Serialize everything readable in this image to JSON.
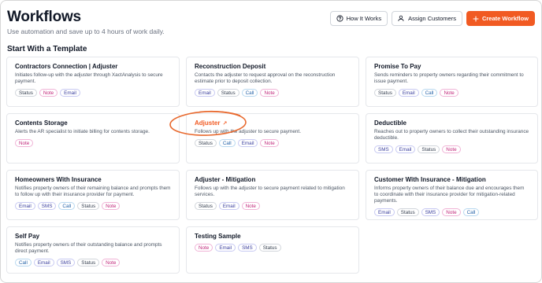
{
  "header": {
    "title": "Workflows",
    "subtitle": "Use automation and save up to 4 hours of work daily.",
    "buttons": {
      "how_it_works": "How It Works",
      "assign_customers": "Assign Customers",
      "create_workflow": "Create Workflow"
    }
  },
  "section_title": "Start With a Template",
  "colors": {
    "accent": "#f15a22",
    "note": "#c0267a",
    "email": "#3b3f9e",
    "call": "#2563a8"
  },
  "templates": [
    {
      "title": "Contractors Connection | Adjuster",
      "desc": "Initiates follow-up with the adjuster through XactAnalysis to secure payment.",
      "tags": [
        "Status",
        "Note",
        "Email"
      ]
    },
    {
      "title": "Reconstruction Deposit",
      "desc": "Contacts the adjuster to request approval on the reconstruction estimate prior to deposit collection.",
      "tags": [
        "Email",
        "Status",
        "Call",
        "Note"
      ]
    },
    {
      "title": "Promise To Pay",
      "desc": "Sends reminders to property owners regarding their commitment to issue payment.",
      "tags": [
        "Status",
        "Email",
        "Call",
        "Note"
      ]
    },
    {
      "title": "Contents Storage",
      "desc": "Alerts the AR specialist to initiate billing for contents storage.",
      "tags": [
        "Note"
      ]
    },
    {
      "title": "Adjuster",
      "desc": "Follows up with the adjuster to secure payment.",
      "tags": [
        "Status",
        "Call",
        "Email",
        "Note"
      ],
      "highlight": true,
      "link_glyph": "↗"
    },
    {
      "title": "Deductible",
      "desc": "Reaches out to property owners to collect their outstanding insurance deductible.",
      "tags": [
        "SMS",
        "Email",
        "Status",
        "Note"
      ]
    },
    {
      "title": "Homeowners With Insurance",
      "desc": "Notifies property owners of their remaining balance and prompts them to follow up with their insurance provider for payment.",
      "tags": [
        "Email",
        "SMS",
        "Call",
        "Status",
        "Note"
      ]
    },
    {
      "title": "Adjuster - Mitigation",
      "desc": "Follows up with the adjuster to secure payment related to mitigation services.",
      "tags": [
        "Status",
        "Email",
        "Note"
      ]
    },
    {
      "title": "Customer With Insurance - Mitigation",
      "desc": "Informs property owners of their balance due and encourages them to coordinate with their insurance provider for mitigation-related payments.",
      "tags": [
        "Email",
        "Status",
        "SMS",
        "Note",
        "Call"
      ]
    },
    {
      "title": "Self Pay",
      "desc": "Notifies property owners of their outstanding balance and prompts direct payment.",
      "tags": [
        "Call",
        "Email",
        "SMS",
        "Status",
        "Note"
      ]
    },
    {
      "title": "Testing Sample",
      "desc": "",
      "tags": [
        "Note",
        "Email",
        "SMS",
        "Status"
      ]
    }
  ]
}
